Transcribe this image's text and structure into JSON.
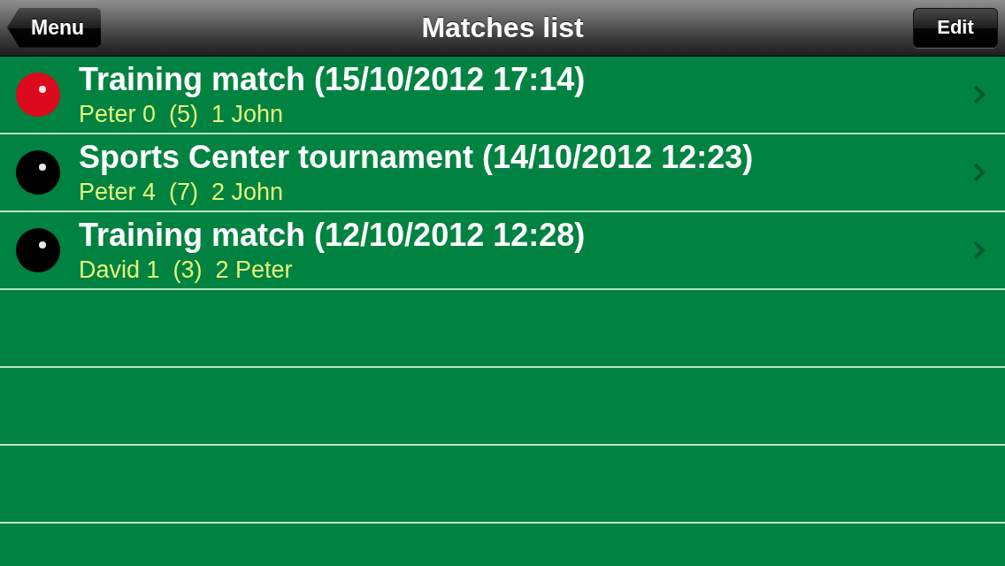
{
  "nav_bar": {
    "back_button": "Menu",
    "title": "Matches list",
    "edit_button": "Edit"
  },
  "matches": [
    {
      "title": "Training match (15/10/2012 17:14)",
      "score": "Peter 0  (5)  1 John",
      "color": "#dc0a1c"
    },
    {
      "title": "Sports Center tournament (14/10/2012 12:23)",
      "score": "Peter 4  (7)  2 John",
      "color": "#000000"
    },
    {
      "title": "Training match (12/10/2012 12:28)",
      "score": "David 1  (3)  2 Peter",
      "color": "#000000"
    }
  ]
}
